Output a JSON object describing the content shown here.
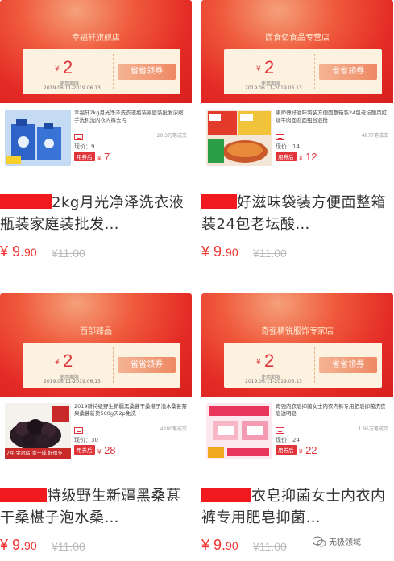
{
  "products": [
    {
      "shop": "幸福轩旗舰店",
      "coupon_currency": "¥",
      "coupon_amount": "2",
      "coupon_note": "使用期限",
      "coupon_dates": "2019.06.11-2019.06.13",
      "coupon_action": "省省领券",
      "title_small": "幸福轩2kg月光净泽洗衣液瓶装家庭装批发浓缩手洗机洗内衣内裤去污",
      "sales": "20.3万笔成交",
      "now_price_label": "现价：",
      "now_price": "9",
      "coupon_tag": "用券后",
      "final_currency": "¥",
      "final_price": "7",
      "name_visible": "2kg月光净泽洗衣液瓶装家庭装批发…",
      "price_currency": "¥",
      "price_int": "9.",
      "price_dec": "90",
      "price_orig": "¥11.00"
    },
    {
      "shop": "西食亿食品专营店",
      "coupon_currency": "¥",
      "coupon_amount": "2",
      "coupon_note": "使用期限",
      "coupon_dates": "2019.06.11-2019.06.13",
      "coupon_action": "省省领券",
      "title_small": "康师傅好滋味袋装方便面整箱装24包老坛酸菜红烧牛肉面泡面组合混搭",
      "sales": "4877笔成交",
      "now_price_label": "现价：",
      "now_price": "14",
      "coupon_tag": "用券后",
      "final_currency": "¥",
      "final_price": "12",
      "name_visible": "好滋味袋装方便面整箱装24包老坛酸…",
      "price_currency": "¥",
      "price_int": "9.",
      "price_dec": "90",
      "price_orig": "¥11.00"
    },
    {
      "shop": "西部臻品",
      "coupon_currency": "¥",
      "coupon_amount": "2",
      "coupon_note": "使用期限",
      "coupon_dates": "2019.06.11-2019.06.13",
      "coupon_action": "省省领券",
      "title_small": "2019新特级野生新疆黑桑葚干桑椹子泡水桑葚茶果桑葚新货500g天2p免洗",
      "sales": "4280笔成交",
      "now_price_label": "现价：",
      "now_price": "30",
      "coupon_tag": "用券后",
      "final_currency": "¥",
      "final_price": "28",
      "badge": "7年 金冠店 贵一成 好很多",
      "name_visible": "特级野生新疆黑桑葚干桑椹子泡水桑…",
      "price_currency": "¥",
      "price_int": "9.",
      "price_dec": "90",
      "price_orig": "¥11.00"
    },
    {
      "shop": "奇强精锐服饰专家店",
      "coupon_currency": "¥",
      "coupon_amount": "2",
      "coupon_note": "使用期限",
      "coupon_dates": "2019.06.11-2019.06.13",
      "coupon_action": "省省领券",
      "title_small": "奇强内衣皂抑菌女士内衣内裤专用肥皂抑菌洗衣皂透明皂",
      "sales": "1.95万笔成交",
      "now_price_label": "现价：",
      "now_price": "24",
      "coupon_tag": "用券后",
      "final_currency": "¥",
      "final_price": "22",
      "name_visible": "衣皂抑菌女士内衣内裤专用肥皂抑菌…",
      "price_currency": "¥",
      "price_int": "9.",
      "price_dec": "90",
      "price_orig": "¥11.00"
    }
  ],
  "watermark": "无极领域"
}
